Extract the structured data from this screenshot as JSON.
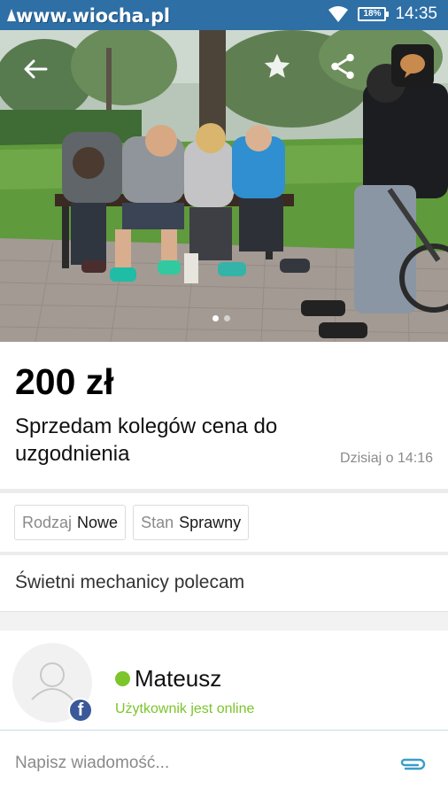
{
  "status_bar": {
    "watermark": "www.wiocha.pl",
    "battery": "18%",
    "time": "14:35",
    "background_color": "#2e6fa6"
  },
  "listing": {
    "price": "200 zł",
    "title": "Sprzedam kolegów cena do uzgodnienia",
    "date": "Dzisiaj o 14:16",
    "photo_count": 2,
    "active_photo_index": 0,
    "params": [
      {
        "label": "Rodzaj",
        "value": "Nowe"
      },
      {
        "label": "Stan",
        "value": "Sprawny"
      }
    ],
    "description": "Świetni mechanicy polecam"
  },
  "seller": {
    "name": "Mateusz",
    "status": "Użytkownik jest online",
    "status_color": "#7cc52c",
    "badge": "f"
  },
  "message": {
    "placeholder": "Napisz wiadomość..."
  },
  "icons": [
    "back-arrow-icon",
    "star-icon",
    "share-icon",
    "chat-bubble-icon",
    "wifi-icon",
    "battery-icon",
    "facebook-icon",
    "paperclip-icon",
    "user-silhouette-icon"
  ]
}
